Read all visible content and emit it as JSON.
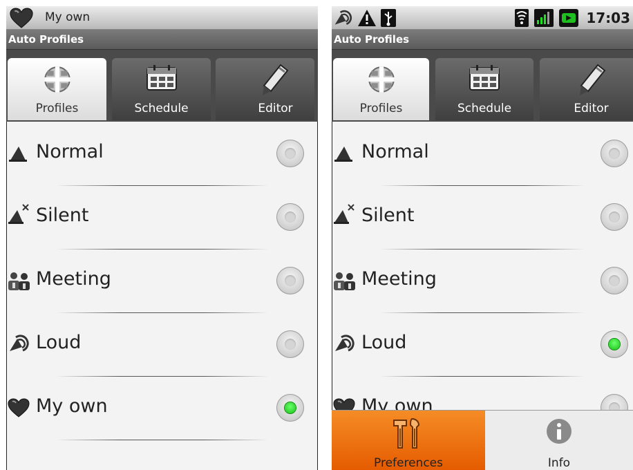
{
  "colors": {
    "accent_selected": "#1fd91f",
    "menu_highlight": "#f07518",
    "title_bar": "#6a6a6a"
  },
  "left_screen": {
    "status_bar": {
      "title": "My own",
      "icon": "heart-icon"
    },
    "app_title": "Auto Profiles",
    "tabs": [
      {
        "label": "Profiles",
        "icon": "profiles-icon",
        "selected": true
      },
      {
        "label": "Schedule",
        "icon": "calendar-icon",
        "selected": false
      },
      {
        "label": "Editor",
        "icon": "pencil-icon",
        "selected": false
      }
    ],
    "profiles": [
      {
        "label": "Normal",
        "icon": "speaker-icon",
        "selected": false
      },
      {
        "label": "Silent",
        "icon": "speaker-muted-icon",
        "selected": false
      },
      {
        "label": "Meeting",
        "icon": "meeting-people-icon",
        "selected": false
      },
      {
        "label": "Loud",
        "icon": "speaker-loud-icon",
        "selected": false
      },
      {
        "label": "My own",
        "icon": "heart-icon",
        "selected": true
      }
    ]
  },
  "right_screen": {
    "status_bar": {
      "time": "17:03",
      "icons": [
        "loud-speaker-icon",
        "warning-icon",
        "usb-icon",
        "wifi-icon",
        "signal-icon",
        "battery-icon"
      ]
    },
    "app_title": "Auto Profiles",
    "tabs": [
      {
        "label": "Profiles",
        "icon": "profiles-icon",
        "selected": true
      },
      {
        "label": "Schedule",
        "icon": "calendar-icon",
        "selected": false
      },
      {
        "label": "Editor",
        "icon": "pencil-icon",
        "selected": false
      }
    ],
    "profiles": [
      {
        "label": "Normal",
        "icon": "speaker-icon",
        "selected": false
      },
      {
        "label": "Silent",
        "icon": "speaker-muted-icon",
        "selected": false
      },
      {
        "label": "Meeting",
        "icon": "meeting-people-icon",
        "selected": false
      },
      {
        "label": "Loud",
        "icon": "speaker-loud-icon",
        "selected": true
      },
      {
        "label": "My own",
        "icon": "heart-icon",
        "selected": false
      }
    ],
    "options_menu": [
      {
        "label": "Preferences",
        "icon": "tools-icon",
        "highlighted": true
      },
      {
        "label": "Info",
        "icon": "info-icon",
        "highlighted": false
      }
    ]
  }
}
